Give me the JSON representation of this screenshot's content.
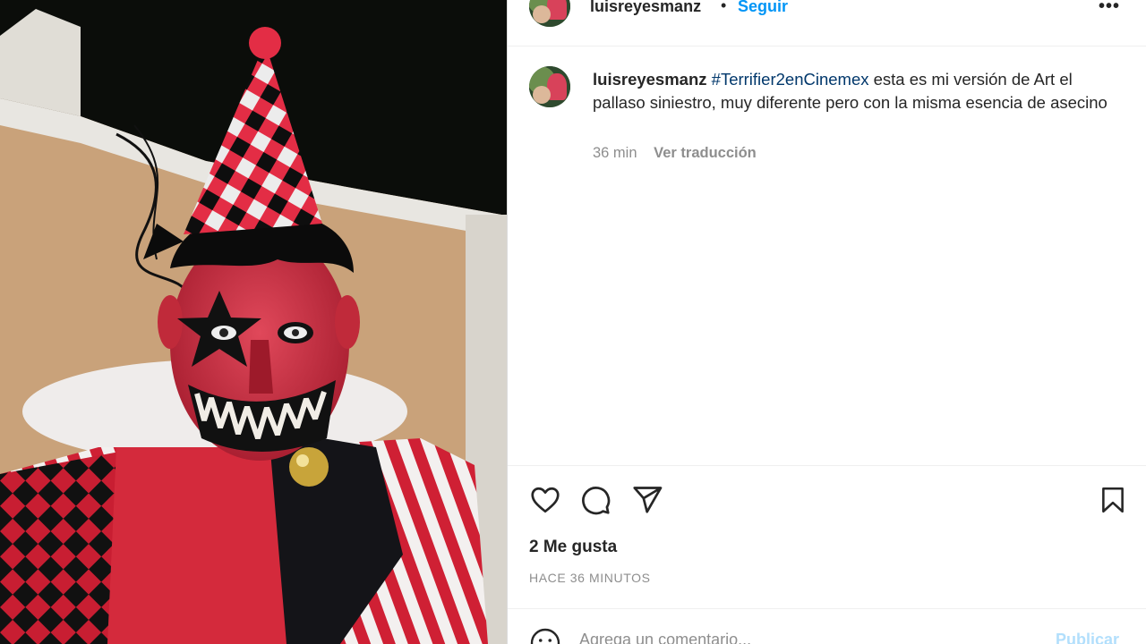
{
  "post": {
    "image_alt": "Persona disfrazada de payaso siniestro con gorro a rombos rojos y negros",
    "header": {
      "username": "luisreyesmanz",
      "separator": "•",
      "follow_label": "Seguir",
      "more_label": "•••"
    },
    "caption": {
      "username": "luisreyesmanz",
      "hashtag": "#Terrifier2enCinemex",
      "text": " esta es mi versión de Art el pallaso siniestro, muy diferente pero con la misma esencia de asecino",
      "time": "36 min",
      "translate_label": "Ver traducción"
    },
    "actions": {
      "like_icon": "heart-icon",
      "comment_icon": "comment-icon",
      "share_icon": "paper-plane-icon",
      "save_icon": "bookmark-icon"
    },
    "likes_text": "2 Me gusta",
    "time_text": "HACE 36 MINUTOS",
    "comment_box": {
      "placeholder": "Agrega un comentario...",
      "publish_label": "Publicar"
    }
  },
  "colors": {
    "accent": "#0095f6",
    "hashtag": "#00376b",
    "muted": "#8e8e8e",
    "publish_disabled": "#b2dffc"
  }
}
